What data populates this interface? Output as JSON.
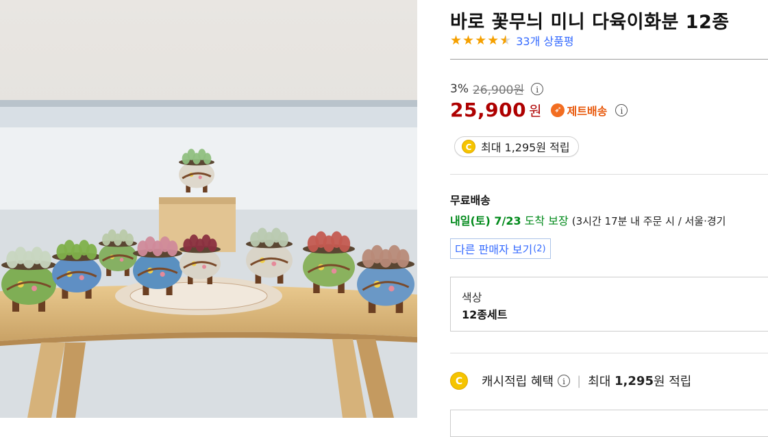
{
  "product": {
    "title": "바로 꽃무늬 미니 다육이화분 12종",
    "rating_stars": 4.5,
    "review_count": "33개",
    "review_suffix": "상품평"
  },
  "price": {
    "discount_rate": "3%",
    "original_price": "26,900원",
    "sale_price": "25,900",
    "unit": "원",
    "delivery_badge": "제트배송",
    "info_icon": "i"
  },
  "cashback": {
    "coin_letter": "C",
    "text": "최대 1,295원 적립"
  },
  "shipping": {
    "label": "무료배송",
    "arrival_date": "내일(토) 7/23",
    "arrival_guarantee": "도착 보장",
    "arrival_detail": "(3시간 17분  내 주문 시 / 서울·경기"
  },
  "other_sellers": {
    "label": "다른 판매자 보기",
    "count": "(2)"
  },
  "option": {
    "label": "색상",
    "value": "12종세트"
  },
  "benefit": {
    "label": "캐시적립 혜택",
    "prefix": "최대",
    "amount": "1,295",
    "suffix": "원 적립"
  },
  "colors": {
    "accent_blue": "#346aff",
    "price_red": "#ae0000",
    "arrival_green": "#00891a",
    "star_orange": "#f5a000",
    "rocket_orange": "#e8590c"
  },
  "icons": [
    "star-icon",
    "info-icon",
    "rocket-delivery-icon",
    "cash-coin-icon"
  ]
}
